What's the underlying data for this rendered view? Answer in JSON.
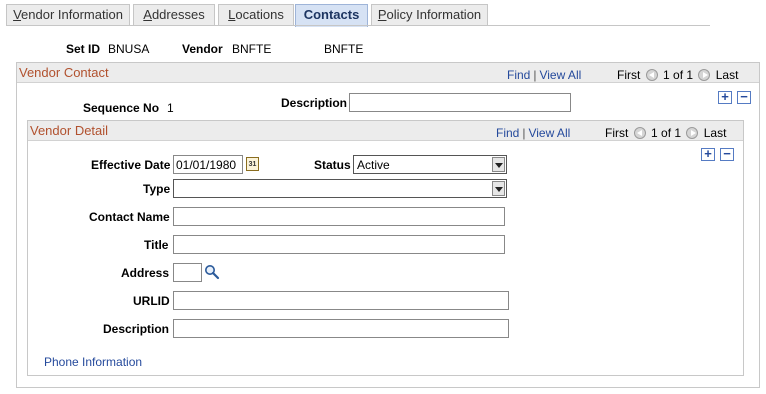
{
  "tabs": [
    {
      "label": "Vendor Information",
      "underline": "V",
      "rest": "endor Information",
      "active": false
    },
    {
      "label": "Addresses",
      "underline": "A",
      "rest": "ddresses",
      "active": false
    },
    {
      "label": "Locations",
      "underline": "L",
      "rest": "ocations",
      "active": false
    },
    {
      "label": "Contacts",
      "active": true
    },
    {
      "label": "Policy Information",
      "underline": "P",
      "rest": "olicy Information",
      "active": false
    }
  ],
  "header": {
    "setid_label": "Set ID",
    "setid_value": "BNUSA",
    "vendor_label": "Vendor",
    "vendor_value": "BNFTE",
    "vendor_name": "BNFTE"
  },
  "vendor_contact": {
    "title": "Vendor Contact",
    "find": "Find",
    "view_all": "View All",
    "first": "First",
    "count": "1 of 1",
    "last": "Last",
    "seq_label": "Sequence No",
    "seq_value": "1",
    "desc_label": "Description",
    "desc_value": "",
    "add": "+",
    "remove": "−"
  },
  "vendor_detail": {
    "title": "Vendor Detail",
    "find": "Find",
    "view_all": "View All",
    "first": "First",
    "count": "1 of 1",
    "last": "Last",
    "add": "+",
    "remove": "−",
    "effdt_label": "Effective Date",
    "effdt_value": "01/01/1980",
    "calendar_glyph": "31",
    "status_label": "Status",
    "status_value": "Active",
    "type_label": "Type",
    "type_value": "",
    "contact_name_label": "Contact Name",
    "contact_name_value": "",
    "title_label": "Title",
    "title_value": "",
    "address_label": "Address",
    "address_value": "",
    "urlid_label": "URLID",
    "urlid_value": "",
    "description_label": "Description",
    "description_value": "",
    "phone_link": "Phone Information"
  },
  "colors": {
    "section_title": "#b1512e",
    "link": "#254a9c",
    "active_tab": "#d6e2f4"
  }
}
